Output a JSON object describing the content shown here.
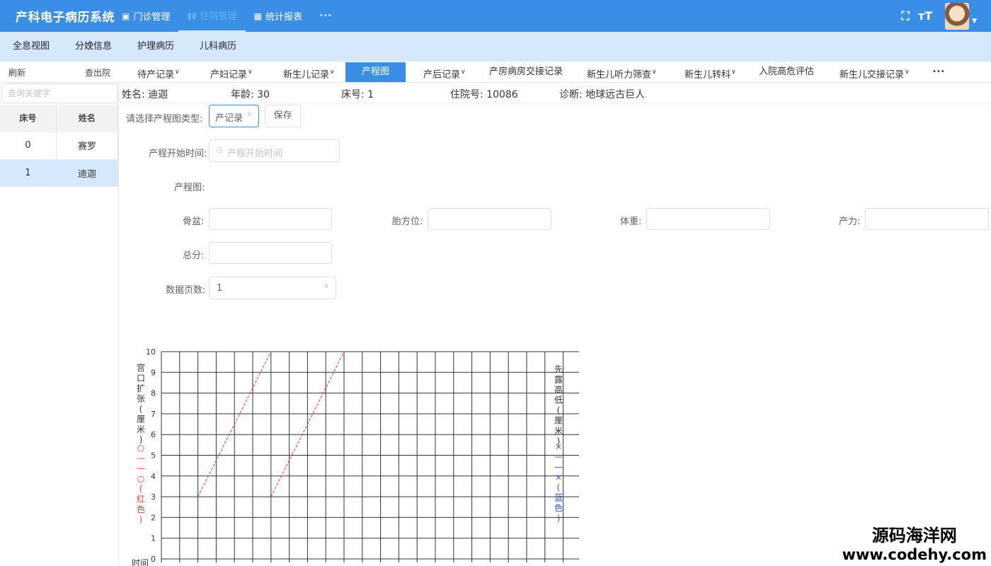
{
  "app": {
    "title": "产科电子病历系统"
  },
  "topnav": [
    {
      "icon": "outpatient-icon",
      "label": "门诊管理"
    },
    {
      "icon": "inpatient-chart-icon",
      "label": "住院管理"
    },
    {
      "icon": "grid-report-icon",
      "label": "统计报表"
    },
    {
      "icon": "more-icon",
      "label": "•••"
    }
  ],
  "topbar_icons": [
    "fullscreen-icon",
    "font-size-icon",
    "avatar",
    "caret-down-icon"
  ],
  "subnav": [
    "全息视图",
    "分娩信息",
    "护理病历",
    "儿科病历"
  ],
  "toolbar": {
    "refresh": "刷新",
    "discharge": "查出院"
  },
  "tabs": [
    {
      "label": "待产记录",
      "dropdown": true
    },
    {
      "label": "产妇记录",
      "dropdown": true
    },
    {
      "label": "新生儿记录",
      "dropdown": true
    },
    {
      "label": "产程图",
      "dropdown": false,
      "active": true
    },
    {
      "label": "产后记录",
      "dropdown": true
    },
    {
      "label": "产房病房交接记录",
      "dropdown": false
    },
    {
      "label": "新生儿听力筛查",
      "dropdown": true
    },
    {
      "label": "新生儿转科",
      "dropdown": true
    },
    {
      "label": "入院高危评估",
      "dropdown": false
    },
    {
      "label": "新生儿交接记录",
      "dropdown": true
    },
    {
      "label": "•••",
      "dropdown": false
    }
  ],
  "sidebar": {
    "search_placeholder": "查询关键字",
    "columns": [
      "床号",
      "姓名"
    ],
    "rows": [
      {
        "bed": "0",
        "name": "赛罗",
        "selected": false
      },
      {
        "bed": "1",
        "name": "迪迦",
        "selected": true
      }
    ]
  },
  "patient": {
    "name_label": "姓名:",
    "name": "迪迦",
    "age_label": "年龄:",
    "age": "30",
    "bed_label": "床号:",
    "bed": "1",
    "admission_label": "住院号:",
    "admission_no": "10086",
    "diagnosis_label": "诊断:",
    "diagnosis": "地球远古巨人"
  },
  "form": {
    "type_label": "请选择产程图类型:",
    "type_value": "产记录",
    "save_label": "保存",
    "start_time_label": "产程开始时间:",
    "start_time_placeholder": "产程开始时间",
    "chart_label": "产程图:",
    "pelvis_label": "骨盆:",
    "fetal_position_label": "胎方位:",
    "weight_label": "体重:",
    "labor_force_label": "产力:",
    "total_label": "总分:",
    "pages_label": "数据页数:",
    "pages_value": "1"
  },
  "chart_data": {
    "type": "line",
    "y_ticks": [
      "0",
      "1",
      "2",
      "3",
      "4",
      "5",
      "6",
      "7",
      "8",
      "9",
      "10"
    ],
    "ylim": [
      0,
      10
    ],
    "x_label": "时间",
    "x_columns": 23,
    "left_axis_title": "宫口扩张(厘米)",
    "left_axis_legend": "○——○(红色)",
    "right_axis_title": "先露高低(厘米)",
    "right_axis_legend": "×——×(蓝色)",
    "grid": true,
    "series": [
      {
        "style": "dashed",
        "color": "#ff3b30",
        "points": [
          [
            2,
            3
          ],
          [
            6,
            10
          ]
        ]
      },
      {
        "style": "dashed",
        "color": "#ff3b30",
        "points": [
          [
            6,
            3
          ],
          [
            10,
            10
          ]
        ]
      }
    ]
  },
  "watermark": {
    "line1": "源码海洋网",
    "line2": "www.codehy.com"
  },
  "colors": {
    "primary": "#3a8ee6",
    "subnav_bg": "#d6e8fc",
    "diagnosis": "#e02020"
  }
}
